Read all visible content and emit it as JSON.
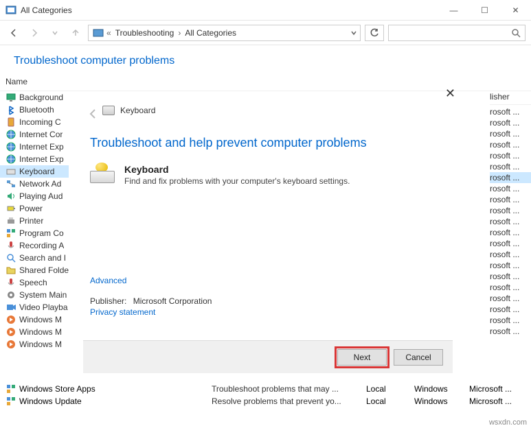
{
  "window": {
    "title": "All Categories"
  },
  "breadcrumb": {
    "items": [
      "Troubleshooting",
      "All Categories"
    ]
  },
  "heading": "Troubleshoot computer problems",
  "columns": {
    "name": "Name",
    "publisher": "lisher"
  },
  "sidebar": {
    "items": [
      {
        "label": "Background",
        "icon": "monitor-icon"
      },
      {
        "label": "Bluetooth",
        "icon": "bluetooth-icon"
      },
      {
        "label": "Incoming C",
        "icon": "phone-icon"
      },
      {
        "label": "Internet Cor",
        "icon": "globe-icon"
      },
      {
        "label": "Internet Exp",
        "icon": "globe-icon"
      },
      {
        "label": "Internet Exp",
        "icon": "globe-icon"
      },
      {
        "label": "Keyboard",
        "icon": "keyboard-icon",
        "selected": true
      },
      {
        "label": "Network Ad",
        "icon": "network-icon"
      },
      {
        "label": "Playing Aud",
        "icon": "speaker-icon"
      },
      {
        "label": "Power",
        "icon": "battery-icon"
      },
      {
        "label": "Printer",
        "icon": "printer-icon"
      },
      {
        "label": "Program Co",
        "icon": "app-icon"
      },
      {
        "label": "Recording A",
        "icon": "mic-icon"
      },
      {
        "label": "Search and I",
        "icon": "search-icon"
      },
      {
        "label": "Shared Folde",
        "icon": "folder-icon"
      },
      {
        "label": "Speech",
        "icon": "mic-icon"
      },
      {
        "label": "System Main",
        "icon": "gear-icon"
      },
      {
        "label": "Video Playba",
        "icon": "video-icon"
      },
      {
        "label": "Windows M",
        "icon": "wmp-icon"
      },
      {
        "label": "Windows M",
        "icon": "wmp-icon"
      },
      {
        "label": "Windows M",
        "icon": "wmp-icon"
      }
    ]
  },
  "publisher_col": {
    "values": [
      "rosoft ...",
      "rosoft ...",
      "rosoft ...",
      "rosoft ...",
      "rosoft ...",
      "rosoft ...",
      "rosoft ...",
      "rosoft ...",
      "rosoft ...",
      "rosoft ...",
      "rosoft ...",
      "rosoft ...",
      "rosoft ...",
      "rosoft ...",
      "rosoft ...",
      "rosoft ...",
      "rosoft ...",
      "rosoft ...",
      "rosoft ...",
      "rosoft ...",
      "rosoft ..."
    ]
  },
  "bottom_rows": [
    {
      "name": "Windows Store Apps",
      "desc": "Troubleshoot problems that may ...",
      "cat": "Local",
      "loc": "Windows",
      "pub": "Microsoft ..."
    },
    {
      "name": "Windows Update",
      "desc": "Resolve problems that prevent yo...",
      "cat": "Local",
      "loc": "Windows",
      "pub": "Microsoft ..."
    }
  ],
  "wizard": {
    "header_title": "Keyboard",
    "heading": "Troubleshoot and help prevent computer problems",
    "item_title": "Keyboard",
    "item_desc": "Find and fix problems with your computer's keyboard settings.",
    "advanced": "Advanced",
    "publisher_label": "Publisher:",
    "publisher_value": "Microsoft Corporation",
    "privacy": "Privacy statement",
    "next": "Next",
    "cancel": "Cancel"
  },
  "watermark": "wsxdn.com"
}
